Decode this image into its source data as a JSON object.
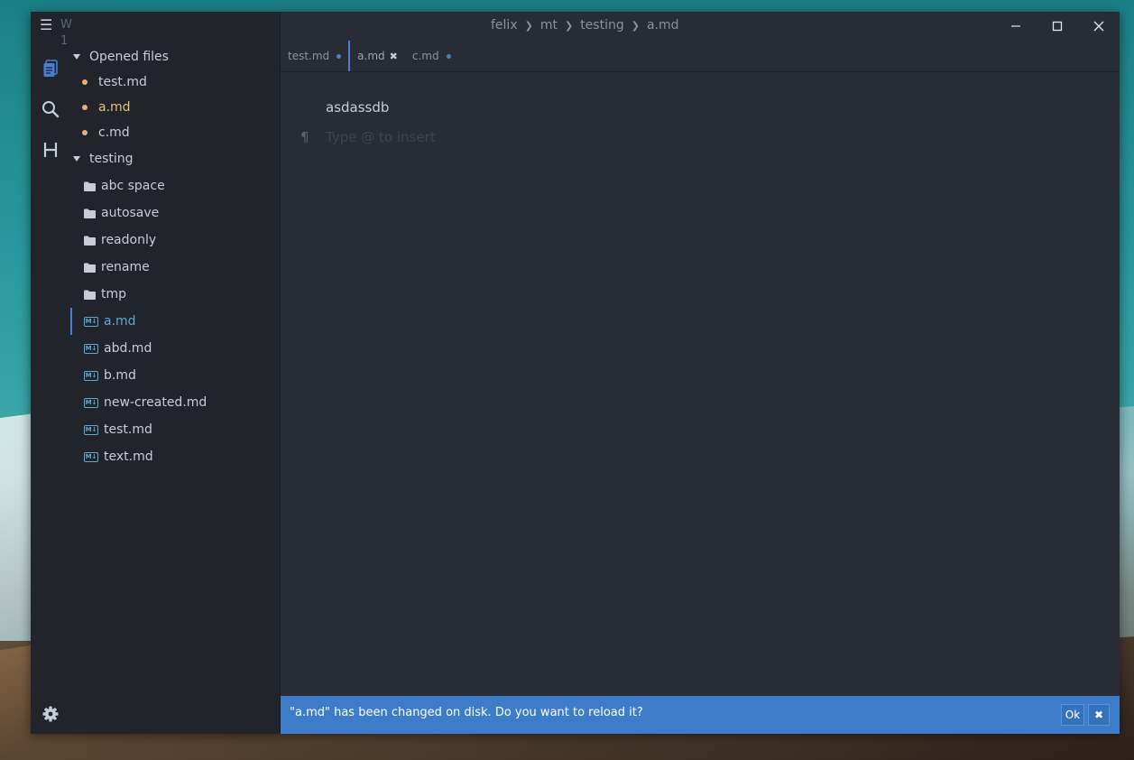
{
  "app": {
    "workspace_label": "W 1",
    "breadcrumb": [
      "felix",
      "mt",
      "testing",
      "a.md"
    ]
  },
  "sidebar": {
    "opened_section_label": "Opened files",
    "opened_files": [
      {
        "name": "test.md"
      },
      {
        "name": "a.md"
      },
      {
        "name": "c.md"
      }
    ],
    "folder_section_label": "testing",
    "folders": [
      "abc space",
      "autosave",
      "readonly",
      "rename",
      "tmp"
    ],
    "files": [
      "a.md",
      "abd.md",
      "b.md",
      "new-created.md",
      "test.md",
      "text.md"
    ],
    "md_badge": "M↓"
  },
  "tabs": [
    {
      "label": "test.md"
    },
    {
      "label": "a.md"
    },
    {
      "label": "c.md"
    }
  ],
  "editor": {
    "content_line": "asdassdb",
    "pilcrow": "¶",
    "placeholder": "Type @ to insert"
  },
  "notification": {
    "message": "\"a.md\" has been changed on disk. Do you want to reload it?",
    "ok_label": "Ok",
    "close_label": "✖"
  },
  "colors": {
    "accent": "#4a7fd0",
    "modified_dot": "#e5b07a",
    "active_file": "#5fa8d3",
    "notification_bg": "#3d7cc9"
  }
}
